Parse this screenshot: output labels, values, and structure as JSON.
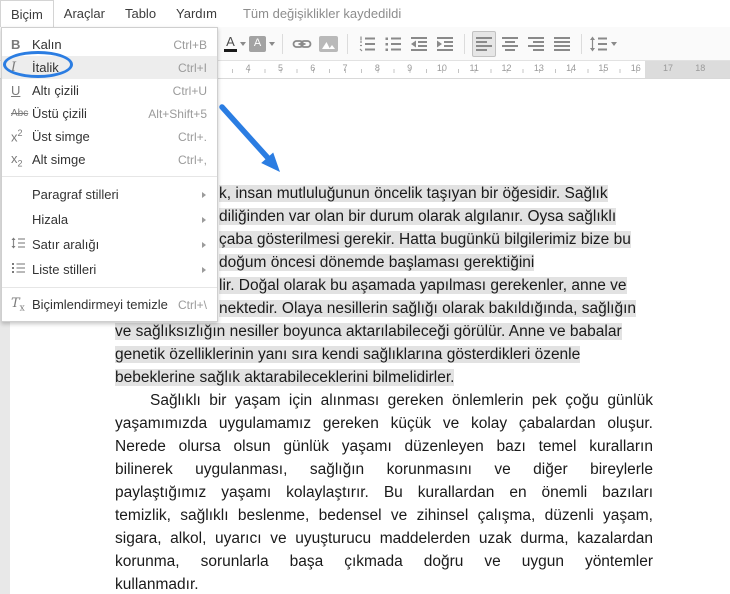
{
  "menubar": {
    "items": [
      {
        "label": "Biçim"
      },
      {
        "label": "Araçlar"
      },
      {
        "label": "Tablo"
      },
      {
        "label": "Yardım"
      }
    ],
    "status": "Tüm değişiklikler kaydedildi"
  },
  "format_menu": {
    "items": [
      {
        "glyph": "B",
        "label": "Kalın",
        "shortcut": "Ctrl+B"
      },
      {
        "glyph": "I",
        "label": "İtalik",
        "shortcut": "Ctrl+I",
        "highlighted": true,
        "annotation": "blue-circle"
      },
      {
        "glyph": "U",
        "label": "Altı çizili",
        "shortcut": "Ctrl+U"
      },
      {
        "glyph": "Abc",
        "label": "Üstü çizili",
        "shortcut": "Alt+Shift+5"
      },
      {
        "glyph": "x",
        "sup": "2",
        "label": "Üst simge",
        "shortcut": "Ctrl+."
      },
      {
        "glyph": "x",
        "sub": "2",
        "label": "Alt simge",
        "shortcut": "Ctrl+,"
      },
      {
        "label": "Paragraf stilleri",
        "submenu": true
      },
      {
        "label": "Hizala",
        "submenu": true
      },
      {
        "label": "Satır aralığı",
        "submenu": true
      },
      {
        "label": "Liste stilleri",
        "submenu": true
      },
      {
        "glyph": "T",
        "sub": "x",
        "label": "Biçimlendirmeyi temizle",
        "shortcut": "Ctrl+\\"
      }
    ]
  },
  "toolbar": {
    "text_color_glyph": "A",
    "highlight_glyph": "A",
    "icons": [
      "text-color",
      "highlight-color",
      "insert-link",
      "insert-image",
      "numbered-list",
      "bulleted-list",
      "decrease-indent",
      "increase-indent",
      "align-left",
      "align-center",
      "align-right",
      "justify",
      "line-spacing"
    ],
    "selected": "align-left"
  },
  "ruler": {
    "numbers": [
      "4",
      "5",
      "6",
      "7",
      "8",
      "9",
      "10",
      "11",
      "12",
      "13",
      "14",
      "15",
      "16",
      "17",
      "18"
    ],
    "margin_marker": "16.5"
  },
  "document": {
    "paragraph1": {
      "selected": true,
      "lines": [
        "k, insan mutluluğunun öncelik taşıyan bir öğesidir. Sağlık",
        "diliğinden var olan bir durum olarak algılanır. Oysa sağlıklı",
        "çaba gösterilmesi gerekir. Hatta bugünkü bilgilerimiz bize bu",
        "doğum öncesi dönemde başlaması gerektiğini",
        "lir. Doğal olarak bu aşamada yapılması gerekenler, anne ve",
        "nektedir. Olaya nesillerin sağlığı olarak bakıldığında, sağlığın",
        "ve sağlıksızlığın nesiller boyunca aktarılabileceği görülür. Anne ve babalar",
        "genetik özelliklerinin yanı sıra kendi sağlıklarına gösterdikleri özenle",
        "bebeklerine sağlık aktarabileceklerini bilmelidirler."
      ]
    },
    "paragraph2": {
      "lines": [
        "Sağlıklı bir yaşam için alınması gereken önlemlerin pek çoğu günlük",
        "yaşamımızda uygulamamız gereken küçük ve kolay çabalardan oluşur.",
        "Nerede olursa olsun günlük yaşamı düzenleyen bazı temel kuralların",
        "bilinerek uygulanması, sağlığın korunmasını ve diğer bireylerle",
        "paylaştığımız yaşamı kolaylaştırır. Bu kurallardan en önemli bazıları",
        "temizlik, sağlıklı beslenme, bedensel ve zihinsel çalışma, düzenli yaşam,",
        "sigara, alkol, uyarıcı ve uyuşturucu maddelerden uzak durma, kazalardan",
        "korunma, sorunlarla başa çıkmada doğru ve uygun yöntemler",
        "kullanmadır."
      ]
    }
  },
  "annotation": {
    "accent_blue": "#2b7de2",
    "selection_grey": "#e2e2e2",
    "marker_blue": "#74a7e8"
  }
}
